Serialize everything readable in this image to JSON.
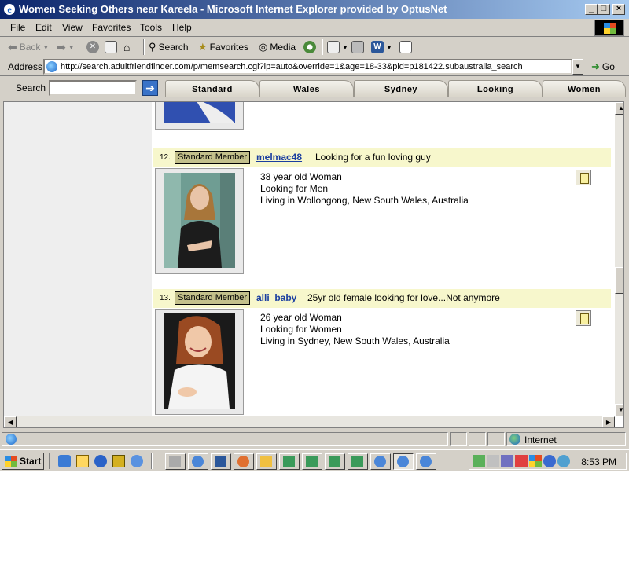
{
  "window": {
    "title": "Women Seeking Others near Kareela - Microsoft Internet Explorer provided by OptusNet",
    "minimize": "_",
    "maximize": "□",
    "close": "×"
  },
  "menu": {
    "items": [
      "File",
      "Edit",
      "View",
      "Favorites",
      "Tools",
      "Help"
    ]
  },
  "toolbar": {
    "back_label": "Back",
    "search_label": "Search",
    "favorites_label": "Favorites",
    "media_label": "Media"
  },
  "address": {
    "label": "Address",
    "url": "http://search.adultfriendfinder.com/p/memsearch.cgi?ip=auto&override=1&age=18-33&pid=p181422.subaustralia_search",
    "go_label": "Go"
  },
  "searchband": {
    "label": "Search",
    "input_value": "",
    "tabs": [
      "Standard",
      "Wales",
      "Sydney",
      "Looking",
      "Women"
    ]
  },
  "profiles": [
    {
      "number": "12.",
      "badge": "Standard Member",
      "username": "melmac48",
      "tagline": "Looking for a fun loving guy",
      "details": [
        "38 year old Woman",
        "Looking for Men",
        "Living in Wollongong, New South Wales, Australia"
      ]
    },
    {
      "number": "13.",
      "badge": "Standard Member",
      "username": "alli_baby",
      "tagline": "25yr old female looking for love...Not anymore",
      "details": [
        "26 year old Woman",
        "Looking for Women",
        "Living in Sydney, New South Wales, Australia"
      ]
    }
  ],
  "statusbar": {
    "zone": "Internet"
  },
  "taskbar": {
    "start_label": "Start",
    "clock": "8:53 PM"
  },
  "colors": {
    "titlebar_start": "#0a246a",
    "titlebar_end": "#a6caf0",
    "profile_bar": "#f7f7cc",
    "badge": "#c3c08b",
    "username_link": "#1a3ea0"
  }
}
